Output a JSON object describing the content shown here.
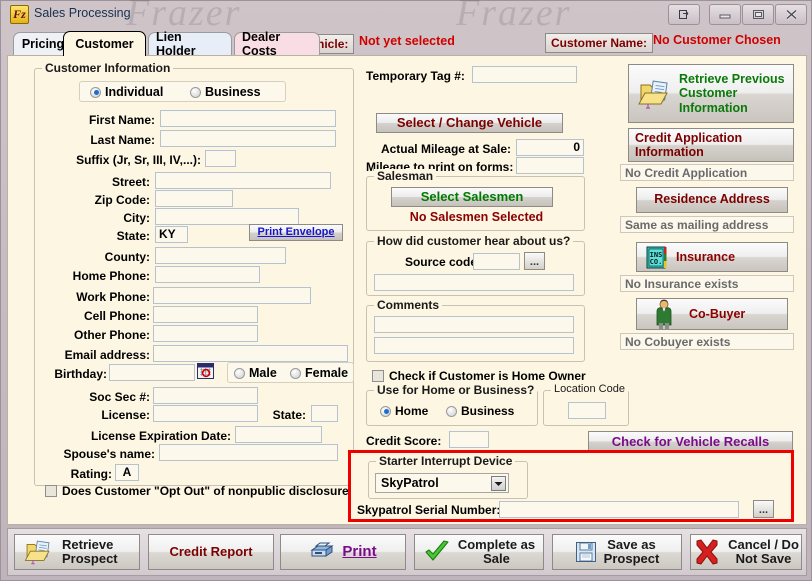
{
  "window": {
    "title": "Sales Processing",
    "app_icon_text": "Fz",
    "watermark": "Frazer",
    "buttons": {
      "restore": "restore",
      "minimize": "minimize",
      "maximize": "maximize",
      "close": "close"
    }
  },
  "tabs": [
    {
      "label": "Pricing",
      "accel": "P",
      "active": false
    },
    {
      "label": "Customer",
      "accel": "C",
      "active": true
    },
    {
      "label": "Lien Holder",
      "accel": "L",
      "active": false
    },
    {
      "label": "Dealer Costs",
      "accel": "D",
      "active": false
    }
  ],
  "header": {
    "vehicle_button": "Vehicle:",
    "vehicle_value": "Not yet selected",
    "customer_button": "Customer Name:",
    "customer_value": "No Customer Chosen"
  },
  "customer_information": {
    "legend": "Customer Information",
    "type_individual": "Individual",
    "type_business": "Business",
    "type_selected": "Individual",
    "fields": {
      "first_name_label": "First Name:",
      "first_name_value": "",
      "last_name_label": "Last Name:",
      "last_name_value": "",
      "suffix_label": "Suffix (Jr, Sr, III, IV,...):",
      "suffix_value": "",
      "street_label": "Street:",
      "street_value": "",
      "zip_label": "Zip Code:",
      "zip_value": "",
      "city_label": "City:",
      "city_value": "",
      "state_label": "State:",
      "state_value": "KY",
      "county_label": "County:",
      "county_value": "",
      "home_phone_label": "Home Phone:",
      "home_phone_value": "",
      "work_phone_label": "Work Phone:",
      "work_phone_value": "",
      "cell_phone_label": "Cell Phone:",
      "cell_phone_value": "",
      "other_phone_label": "Other Phone:",
      "other_phone_value": "",
      "email_label": "Email address:",
      "email_value": "",
      "birthday_label": "Birthday:",
      "birthday_value": "",
      "ssn_label": "Soc Sec #:",
      "ssn_value": "",
      "license_label": "License:",
      "license_value": "",
      "license_state_label": "State:",
      "license_state_value": "",
      "license_exp_label": "License Expiration Date:",
      "license_exp_value": "",
      "spouse_label": "Spouse's name:",
      "spouse_value": "",
      "rating_label": "Rating:",
      "rating_value": "A"
    },
    "print_envelope_button": "Print Envelope",
    "gender_male": "Male",
    "gender_female": "Female",
    "gender_selected": "",
    "opt_out_label": "Does Customer \"Opt Out\" of nonpublic disclosure?",
    "opt_out_checked": false
  },
  "middle": {
    "temp_tag_label": "Temporary Tag #:",
    "temp_tag_value": "",
    "select_vehicle_button": "Select / Change Vehicle",
    "actual_mileage_label": "Actual Mileage at Sale:",
    "actual_mileage_value": "0",
    "print_mileage_label": "Mileage to print on forms:",
    "print_mileage_value": "",
    "salesman_legend": "Salesman",
    "select_salesmen_button": "Select Salesmen",
    "salesmen_status": "No Salesmen Selected",
    "hear_about_legend": "How did customer hear about us?",
    "source_code_label": "Source code:",
    "source_code_value": "",
    "source_code_browse": "...",
    "source_desc_value": "",
    "comments_legend": "Comments",
    "comment_line1": "",
    "comment_line2": "",
    "home_owner_label": "Check if Customer is Home Owner",
    "home_owner_checked": false,
    "use_legend": "Use for Home or Business?",
    "use_home": "Home",
    "use_business": "Business",
    "use_selected": "Home",
    "location_code_legend": "Location Code",
    "location_code_value": "",
    "credit_score_label": "Credit Score:",
    "credit_score_value": ""
  },
  "sidebar": {
    "retrieve_previous": "Retrieve Previous\nCustomer\nInformation",
    "credit_application": "Credit Application\nInformation",
    "credit_application_status": "No Credit Application",
    "residence_address": "Residence Address",
    "residence_status": "Same as mailing address",
    "insurance": "Insurance",
    "insurance_icon_text": "INS CO.",
    "insurance_status": "No Insurance exists",
    "cobuyer": "Co-Buyer",
    "cobuyer_status": "No Cobuyer exists",
    "check_recalls_button": "Check for Vehicle Recalls"
  },
  "starter_interrupt": {
    "legend": "Starter Interrupt Device",
    "device_value": "SkyPatrol",
    "serial_label": "Skypatrol Serial Number:",
    "serial_value": "",
    "serial_browse": "...",
    "border_color": "#ee0000"
  },
  "toolbar": {
    "retrieve_prospect": "Retrieve\nProspect",
    "credit_report": "Credit Report",
    "print": "Print",
    "complete_as_sale": "Complete as\nSale",
    "save_as_prospect": "Save as\nProspect",
    "cancel_do_not_save": "Cancel / Do\nNot Save"
  }
}
